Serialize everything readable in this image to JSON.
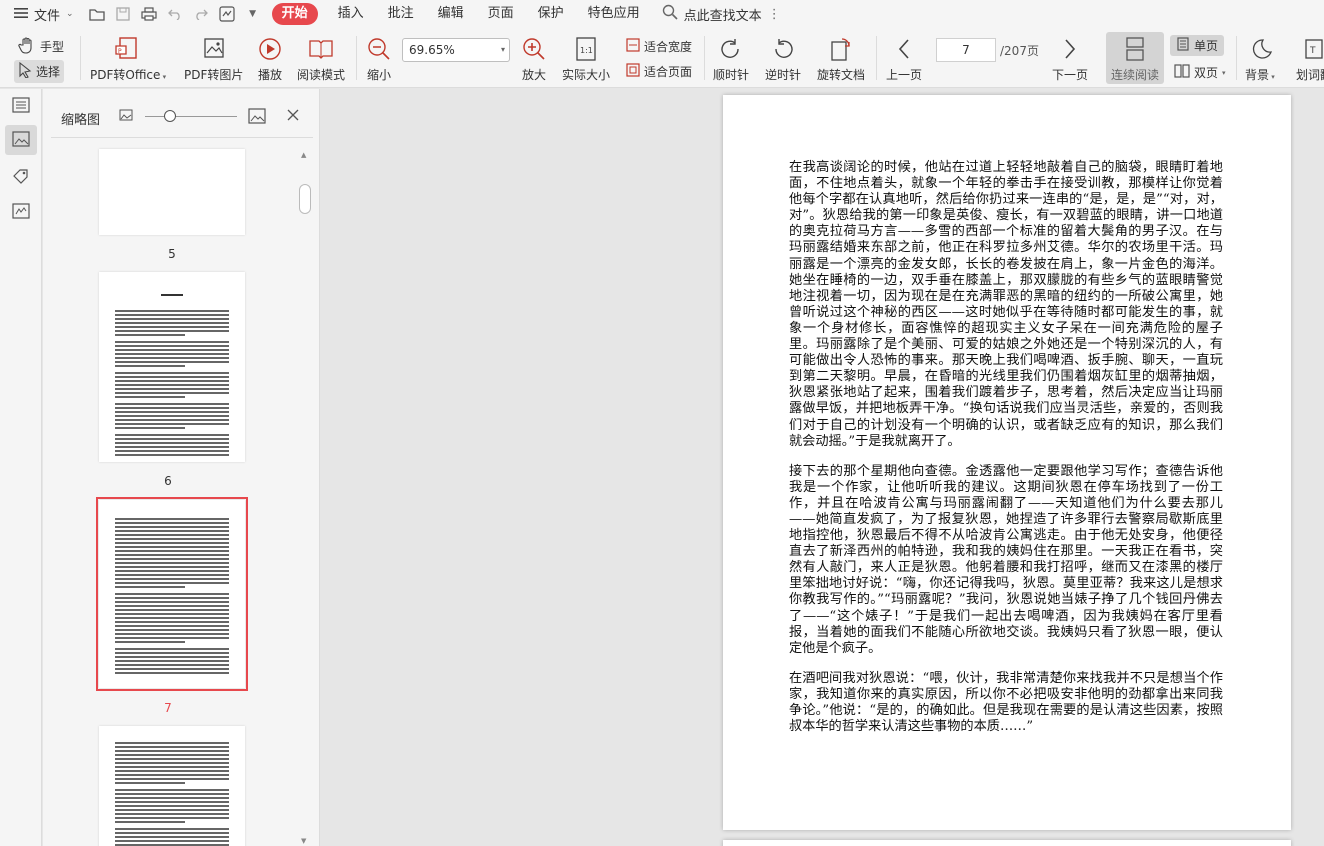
{
  "menubar": {
    "file_label": "文件",
    "items": [
      "开始",
      "插入",
      "批注",
      "编辑",
      "页面",
      "保护",
      "特色应用"
    ],
    "active": "开始",
    "search_label": "点此查找文本"
  },
  "ribbon": {
    "hand_label": "手型",
    "select_label": "选择",
    "pdf_to_office": "PDF转Office",
    "pdf_to_image": "PDF转图片",
    "play": "播放",
    "read_mode": "阅读模式",
    "zoom_out": "缩小",
    "zoom_value": "69.65%",
    "zoom_in": "放大",
    "actual_size": "实际大小",
    "fit_width": "适合宽度",
    "fit_page": "适合页面",
    "clockwise": "顺时针",
    "counterclockwise": "逆时针",
    "rotate_doc": "旋转文档",
    "prev_page": "上一页",
    "page_current": "7",
    "page_total": "/207页",
    "next_page": "下一页",
    "continuous": "连续阅读",
    "single_page": "单页",
    "double_page": "双页",
    "background": "背景",
    "word_select": "划词翻"
  },
  "thumbnail_panel": {
    "title": "缩略图",
    "pages": [
      "5",
      "6",
      "7"
    ],
    "selected_page": "7"
  },
  "document": {
    "paragraphs": [
      "在我高谈阔论的时候，他站在过道上轻轻地敲着自己的脑袋，眼睛盯着地面，不住地点着头，就象一个年轻的拳击手在接受训教，那模样让你觉着他每个字都在认真地听，然后给你扔过来一连串的“是，是，是”“对，对，对”。狄恩给我的第一印象是英俊、瘦长，有一双碧蓝的眼睛，讲一口地道的奥克拉荷马方言——多雪的西部一个标准的留着大鬓角的男子汉。在与玛丽露结婚来东部之前，他正在科罗拉多州艾德。华尔的农场里干活。玛丽露是一个漂亮的金发女郎，长长的卷发披在肩上，象一片金色的海洋。她坐在睡椅的一边，双手垂在膝盖上，那双朦胧的有些乡气的蓝眼睛警觉地注视着一切，因为现在是在充满罪恶的黑暗的纽约的一所破公寓里，她曾听说过这个神秘的西区——这时她似乎在等待随时都可能发生的事，就象一个身材修长，面容憔悴的超现实主义女子呆在一间充满危险的屋子里。玛丽露除了是个美丽、可爱的姑娘之外她还是一个特别深沉的人，有可能做出令人恐怖的事来。那天晚上我们喝啤酒、扳手腕、聊天，一直玩到第二天黎明。早晨，在昏暗的光线里我们仍围着烟灰缸里的烟蒂抽烟，狄恩紧张地站了起来，围着我们踱着步子，思考着，然后决定应当让玛丽露做早饭，并把地板弄干净。“换句话说我们应当灵活些，亲爱的，否则我们对于自己的计划没有一个明确的认识，或者缺乏应有的知识，那么我们就会动摇。”于是我就离开了。",
      "接下去的那个星期他向查德。金透露他一定要跟他学习写作；查德告诉他我是一个作家，让他听听我的建议。这期间狄恩在停车场找到了一份工作，并且在哈波肯公寓与玛丽露闹翻了——天知道他们为什么要去那儿——她简直发疯了，为了报复狄恩，她捏造了许多罪行去警察局歇斯底里地指控他，狄恩最后不得不从哈波肯公寓逃走。由于他无处安身，他便径直去了新泽西州的帕特逊，我和我的姨妈住在那里。一天我正在看书，突然有人敲门，来人正是狄恩。他躬着腰和我打招呼，继而又在漆黑的楼厅里笨拙地讨好说：“嗨，你还记得我吗，狄恩。莫里亚蒂？我来这儿是想求你教我写作的。”“玛丽露呢？”我问，狄恩说她当婊子挣了几个钱回丹佛去了——“这个婊子！”于是我们一起出去喝啤酒，因为我姨妈在客厅里看报，当着她的面我们不能随心所欲地交谈。我姨妈只看了狄恩一眼，便认定他是个疯子。",
      "在酒吧间我对狄恩说：“喂，伙计，我非常清楚你来找我并不只是想当个作家，我知道你来的真实原因，所以你不必把吸安非他明的劲都拿出来同我争论。”他说：“是的，的确如此。但是我现在需要的是认清这些因素，按照叔本华的哲学来认清这些事物的本质……”"
    ]
  }
}
